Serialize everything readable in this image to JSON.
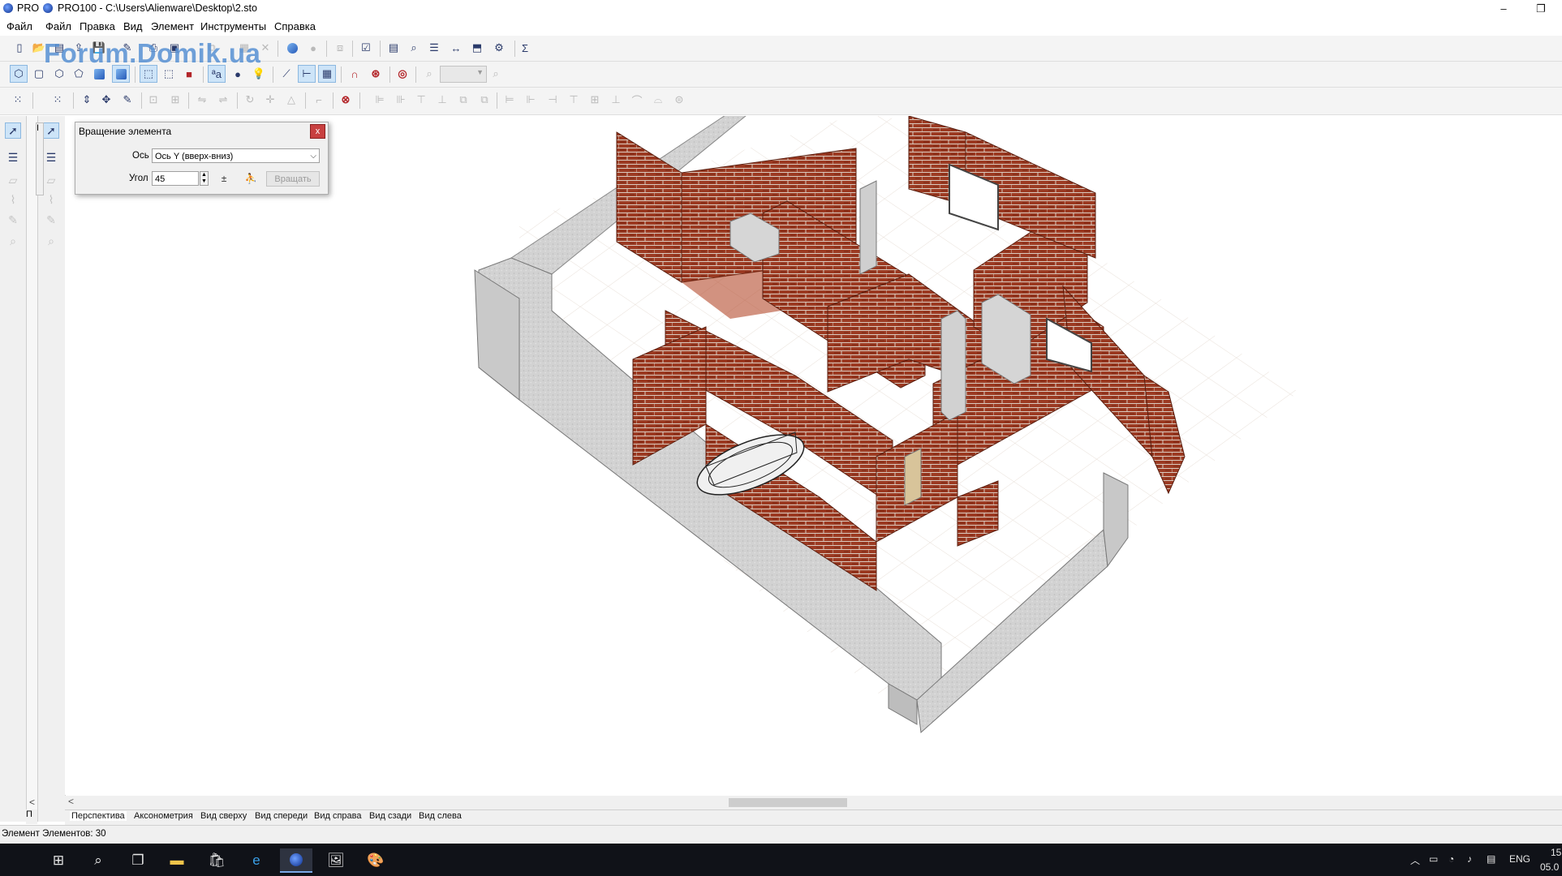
{
  "window": {
    "tab_text": "PRO",
    "title": "PRO100 - C:\\Users\\Alienware\\Desktop\\2.sto",
    "minimize": "–",
    "restore": "❐"
  },
  "menu": [
    "Файл",
    "Файл",
    "Правка",
    "Вид",
    "Элемент",
    "Инструменты",
    "Справка"
  ],
  "watermark": "Forum.Domik.ua",
  "toolbar": {
    "sum_label": "Σ",
    "zoom_value": ""
  },
  "dialog": {
    "title": "Вращение элемента",
    "close": "x",
    "axis_label": "Ось",
    "axis_value": "Ось Y (вверх-вниз)",
    "angle_label": "Угол",
    "angle_value": "45",
    "rotate_button": "Вращать"
  },
  "view_tabs": [
    "Перспектива",
    "Аксонометрия",
    "Вид сверху",
    "Вид спереди",
    "Вид справа",
    "Вид сзади",
    "Вид слева"
  ],
  "left_tab": "П",
  "status": "Элемент Элементов: 30",
  "taskbar": {
    "lang": "ENG",
    "time": "15",
    "date": "05.0"
  },
  "scene": {
    "wall_color": "#9c3a22",
    "mortar_color": "#d9d0c8",
    "slab_color": "#d8d8d8"
  }
}
